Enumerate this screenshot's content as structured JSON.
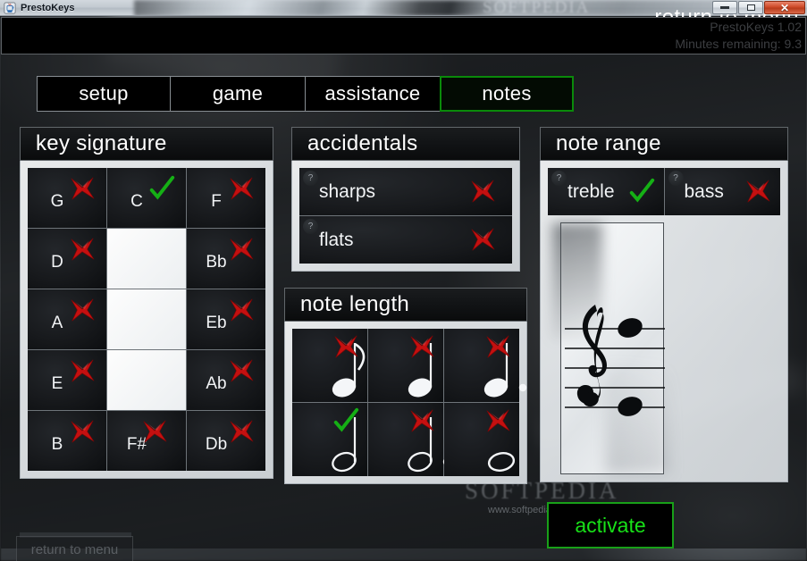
{
  "window": {
    "title": "PrestoKeys",
    "icon": "java-coffee-cup-icon",
    "controls": {
      "minimize": "minimize-button",
      "maximize": "maximize-button",
      "close": "✕"
    }
  },
  "header": {
    "return_to_menu": "return to menu",
    "version_ghost": "PrestoKeys 1.02",
    "minutes_ghost": "Minutes remaining: 9.3"
  },
  "tabs": [
    {
      "label": "setup",
      "active": false
    },
    {
      "label": "game",
      "active": false
    },
    {
      "label": "assistance",
      "active": false
    },
    {
      "label": "notes",
      "active": true
    }
  ],
  "key_signature": {
    "title": "key signature",
    "cells": [
      {
        "label": "G",
        "state": "off",
        "blank": false
      },
      {
        "label": "C",
        "state": "on",
        "blank": false
      },
      {
        "label": "F",
        "state": "off",
        "blank": false
      },
      {
        "label": "D",
        "state": "off",
        "blank": false
      },
      {
        "label": "",
        "state": "blank",
        "blank": true
      },
      {
        "label": "Bb",
        "state": "off",
        "blank": false
      },
      {
        "label": "A",
        "state": "off",
        "blank": false
      },
      {
        "label": "",
        "state": "blank",
        "blank": true
      },
      {
        "label": "Eb",
        "state": "off",
        "blank": false
      },
      {
        "label": "E",
        "state": "off",
        "blank": false
      },
      {
        "label": "",
        "state": "blank",
        "blank": true
      },
      {
        "label": "Ab",
        "state": "off",
        "blank": false
      },
      {
        "label": "B",
        "state": "off",
        "blank": false
      },
      {
        "label": "F#",
        "state": "off",
        "blank": false
      },
      {
        "label": "Db",
        "state": "off",
        "blank": false
      }
    ]
  },
  "accidentals": {
    "title": "accidentals",
    "rows": [
      {
        "label": "sharps",
        "state": "off",
        "help": "?"
      },
      {
        "label": "flats",
        "state": "off",
        "help": "?"
      }
    ]
  },
  "note_length": {
    "title": "note length",
    "cells": [
      {
        "note": "eighth-note",
        "state": "off"
      },
      {
        "note": "quarter-note",
        "state": "off"
      },
      {
        "note": "dotted-quarter-note",
        "state": "off"
      },
      {
        "note": "half-note",
        "state": "on"
      },
      {
        "note": "dotted-half-note",
        "state": "off"
      },
      {
        "note": "whole-note",
        "state": "off"
      }
    ]
  },
  "note_range": {
    "title": "note range",
    "options": [
      {
        "label": "treble",
        "state": "on",
        "help": "?"
      },
      {
        "label": "bass",
        "state": "off",
        "help": "?"
      }
    ],
    "staff": {
      "clef": "treble-clef",
      "lines": 5,
      "notes": [
        {
          "position": "top-line",
          "head": "filled"
        },
        {
          "position": "bottom-line",
          "head": "filled"
        }
      ]
    }
  },
  "activate_button": {
    "label": "activate"
  },
  "footer": {
    "ghost_return": "return to menu"
  },
  "watermark": {
    "brand": "SOFTPEDIA",
    "url": "www.softpedia.com"
  },
  "colors": {
    "accent_green": "#18e018",
    "mark_off_red": "#c41010",
    "mark_on_green": "#15b015",
    "panel_black": "#000000",
    "close_red": "#cf4a28"
  }
}
